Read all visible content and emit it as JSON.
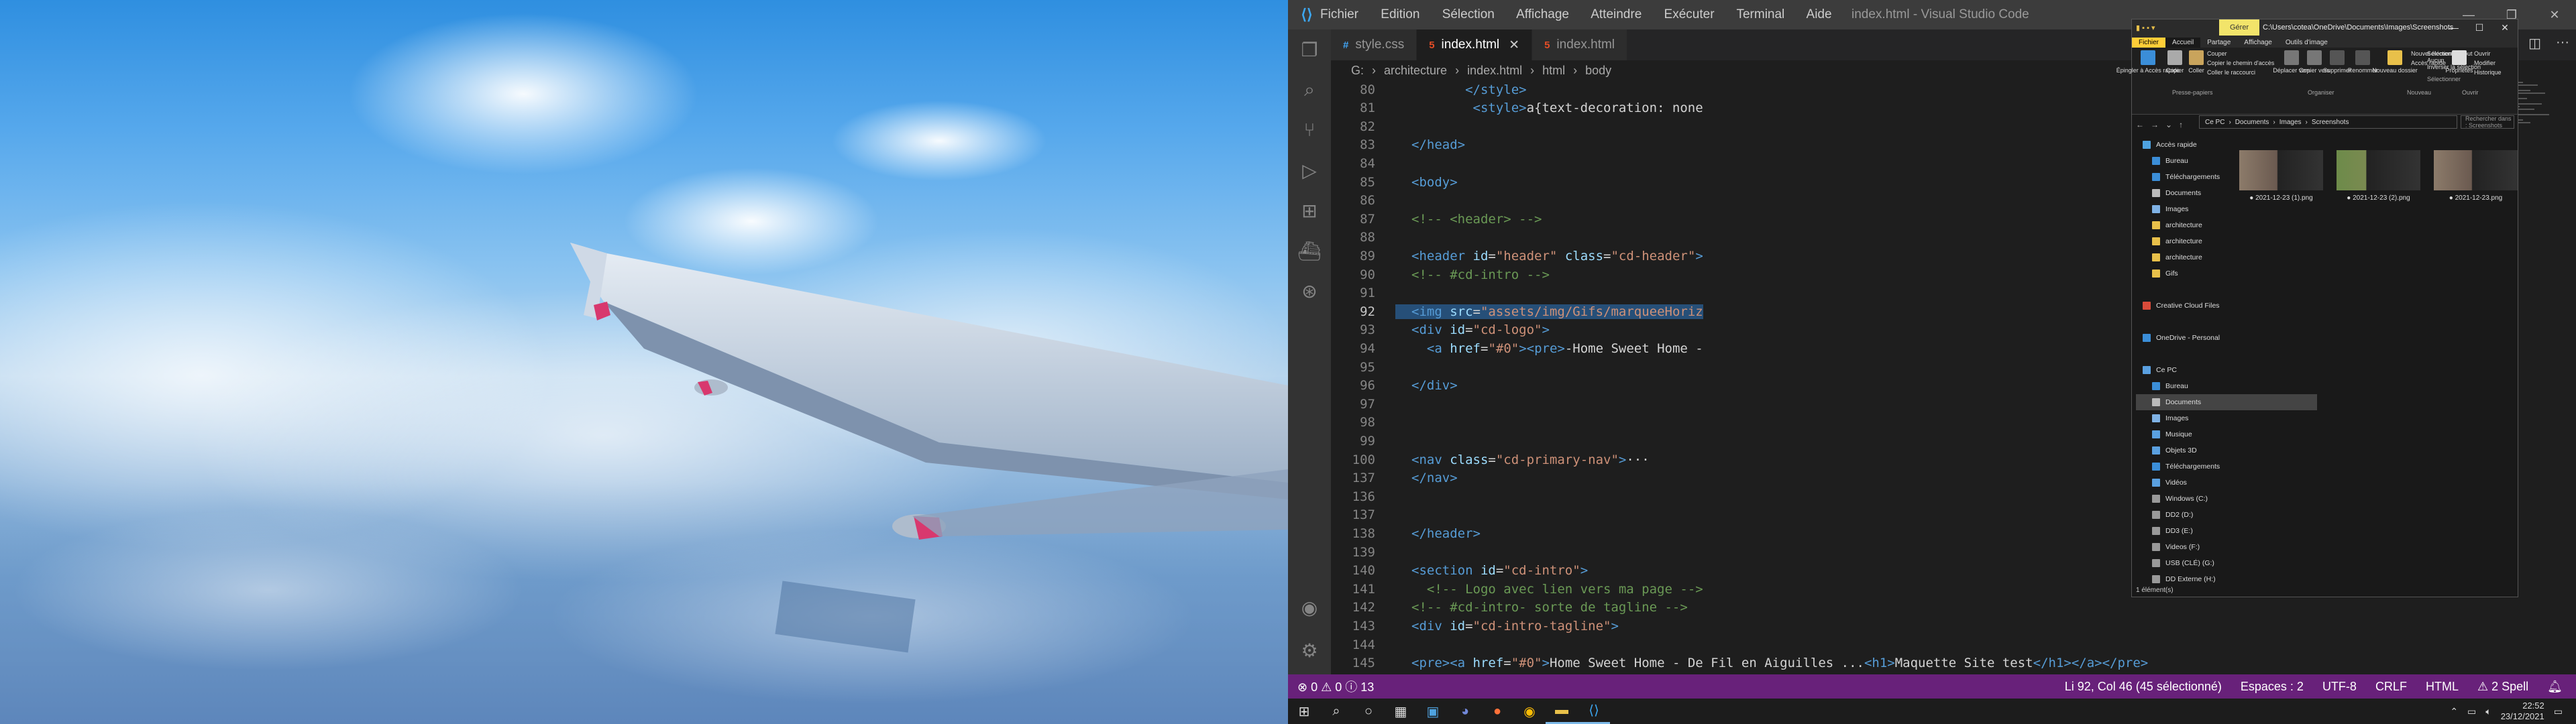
{
  "vscode": {
    "menu": [
      "Fichier",
      "Edition",
      "Sélection",
      "Affichage",
      "Atteindre",
      "Exécuter",
      "Terminal",
      "Aide"
    ],
    "window_title": "index.html - Visual Studio Code",
    "tabs": [
      {
        "icon": "#",
        "icon_color": "#42a5f5",
        "label": "style.css",
        "active": false
      },
      {
        "icon": "5",
        "icon_color": "#e44d26",
        "label": "index.html",
        "active": true
      },
      {
        "icon": "5",
        "icon_color": "#e44d26",
        "label": "index.html",
        "active": false
      }
    ],
    "breadcrumb": [
      "G:",
      "architecture",
      "index.html",
      "html",
      "body"
    ],
    "lines": [
      {
        "n": "80",
        "html": "<span class='txt'>       </span><span class='tag'>&lt;/style&gt;</span>"
      },
      {
        "n": "81",
        "html": "<span class='txt'>        </span><span class='tag'>&lt;style&gt;</span><span class='txt'>a{text-decoration: none</span>"
      },
      {
        "n": "82",
        "html": ""
      },
      {
        "n": "83",
        "html": "<span class='tag'>&lt;/head&gt;</span>"
      },
      {
        "n": "84",
        "html": ""
      },
      {
        "n": "85",
        "html": "<span class='tag'>&lt;body&gt;</span>"
      },
      {
        "n": "86",
        "html": ""
      },
      {
        "n": "87",
        "html": "<span class='cmt'>&lt;!-- &lt;header&gt; --&gt;</span>"
      },
      {
        "n": "88",
        "html": ""
      },
      {
        "n": "89",
        "html": "<span class='tag'>&lt;header </span><span class='attr'>id</span><span class='txt'>=</span><span class='str'>\"header\"</span><span class='attr'> class</span><span class='txt'>=</span><span class='str'>\"cd-header\"</span><span class='tag'>&gt;</span>"
      },
      {
        "n": "90",
        "html": "<span class='cmt'>&lt;!-- #cd-intro --&gt;</span>"
      },
      {
        "n": "91",
        "html": ""
      },
      {
        "n": "92",
        "html": "<span class='tag'>&lt;img </span><span class='attr'>src</span><span class='txt'>=</span><span class='str'>\"assets/img/Gifs/marqueeHoriz</span>",
        "sel": true,
        "cur": true
      },
      {
        "n": "93",
        "html": "<span class='tag'>&lt;div </span><span class='attr'>id</span><span class='txt'>=</span><span class='str'>\"cd-logo\"</span><span class='tag'>&gt;</span>"
      },
      {
        "n": "94",
        "html": "<span class='txt'>  </span><span class='tag'>&lt;a </span><span class='attr'>href</span><span class='txt'>=</span><span class='str'>\"#0\"</span><span class='tag'>&gt;&lt;pre&gt;</span><span class='txt'>-Home Sweet Home -</span>"
      },
      {
        "n": "95",
        "html": ""
      },
      {
        "n": "96",
        "html": "<span class='tag'>&lt;/div&gt;</span>"
      },
      {
        "n": "97",
        "html": ""
      },
      {
        "n": "98",
        "html": ""
      },
      {
        "n": "99",
        "html": ""
      },
      {
        "n": "100",
        "html": "<span class='tag'>&lt;nav </span><span class='attr'>class</span><span class='txt'>=</span><span class='str'>\"cd-primary-nav\"</span><span class='tag'>&gt;</span><span class='txt'>···</span>"
      },
      {
        "n": "137",
        "html": "<span class='tag'>&lt;/nav&gt;</span>"
      },
      {
        "n": "136",
        "html": ""
      },
      {
        "n": "137",
        "html": ""
      },
      {
        "n": "138",
        "html": "<span class='tag'>&lt;/header&gt;</span>"
      },
      {
        "n": "139",
        "html": ""
      },
      {
        "n": "140",
        "html": "<span class='tag'>&lt;section </span><span class='attr'>id</span><span class='txt'>=</span><span class='str'>\"cd-intro\"</span><span class='tag'>&gt;</span>"
      },
      {
        "n": "141",
        "html": "<span class='txt'>  </span><span class='cmt'>&lt;!-- Logo avec lien vers ma page --&gt;</span>"
      },
      {
        "n": "142",
        "html": "<span class='cmt'>&lt;!-- #cd-intro- sorte de tagline --&gt;</span>"
      },
      {
        "n": "143",
        "html": "<span class='tag'>&lt;div </span><span class='attr'>id</span><span class='txt'>=</span><span class='str'>\"cd-intro-tagline\"</span><span class='tag'>&gt;</span>"
      },
      {
        "n": "144",
        "html": ""
      },
      {
        "n": "145",
        "html": "<span class='tag'>&lt;pre&gt;&lt;a </span><span class='attr'>href</span><span class='txt'>=</span><span class='str'>\"#0\"</span><span class='tag'>&gt;</span><span class='txt'>Home Sweet Home - De Fil en Aiguilles ...</span><span class='tag'>&lt;h1&gt;</span><span class='txt'>Maquette Site test</span><span class='tag'>&lt;/h1&gt;&lt;/a&gt;&lt;/pre&gt;</span>"
      }
    ],
    "status": {
      "left": "⊗ 0 ⚠ 0 ⓘ 13",
      "right": [
        "Li 92, Col 46 (45 sélectionné)",
        "Espaces : 2",
        "UTF-8",
        "CRLF",
        "HTML",
        "⚠ 2 Spell"
      ]
    }
  },
  "taskbar": {
    "time": "22:52",
    "date": "23/12/2021"
  },
  "explorer": {
    "title_path": "C:\\Users\\cotea\\OneDrive\\Documents\\Images\\Screenshots",
    "tools_tab": "Gérer",
    "tabs": [
      "Fichier",
      "Accueil",
      "Partage",
      "Affichage",
      "Outils d'image"
    ],
    "ribbon": {
      "pin": "Épingler à Accès rapide",
      "copy": "Copier",
      "paste": "Coller",
      "cut": "Couper",
      "copy_path": "Copier le chemin d'accès",
      "paste_shortcut": "Coller le raccourci",
      "group_clipboard": "Presse-papiers",
      "move_to": "Déplacer vers",
      "copy_to": "Copier vers",
      "delete": "Supprimer",
      "rename": "Renommer",
      "group_organize": "Organiser",
      "new_folder": "Nouveau dossier",
      "new_item": "Nouvel élément",
      "easy_access": "Accès rapide",
      "group_new": "Nouveau",
      "properties": "Propriétés",
      "open": "Ouvrir",
      "edit": "Modifier",
      "history": "Historique",
      "group_open": "Ouvrir",
      "select_all": "Sélectionner tout",
      "select_none": "Aucun",
      "invert": "Inverser la sélection",
      "group_select": "Sélectionner"
    },
    "address": [
      "Ce PC",
      "Documents",
      "Images",
      "Screenshots"
    ],
    "search_placeholder": "Rechercher dans : Screenshots",
    "tree": [
      {
        "label": "Accès rapide",
        "color": "#4fa3e0",
        "indent": 0
      },
      {
        "label": "Bureau",
        "color": "#3b8ed8",
        "indent": 1
      },
      {
        "label": "Téléchargements",
        "color": "#3b8ed8",
        "indent": 1
      },
      {
        "label": "Documents",
        "color": "#bbbbbb",
        "indent": 1
      },
      {
        "label": "Images",
        "color": "#7fb2e5",
        "indent": 1
      },
      {
        "label": "architecture",
        "color": "#e8c04a",
        "indent": 1
      },
      {
        "label": "architecture",
        "color": "#e8c04a",
        "indent": 1
      },
      {
        "label": "architecture",
        "color": "#e8c04a",
        "indent": 1
      },
      {
        "label": "Gifs",
        "color": "#e8c04a",
        "indent": 1
      },
      {
        "label": "",
        "color": "",
        "indent": 0
      },
      {
        "label": "Creative Cloud Files",
        "color": "#d94b3a",
        "indent": 0
      },
      {
        "label": "",
        "color": "",
        "indent": 0
      },
      {
        "label": "OneDrive - Personal",
        "color": "#3b8ed8",
        "indent": 0
      },
      {
        "label": "",
        "color": "",
        "indent": 0
      },
      {
        "label": "Ce PC",
        "color": "#5aa0e0",
        "indent": 0
      },
      {
        "label": "Bureau",
        "color": "#3b8ed8",
        "indent": 1
      },
      {
        "label": "Documents",
        "color": "#bbbbbb",
        "indent": 1,
        "sel": true
      },
      {
        "label": "Images",
        "color": "#7fb2e5",
        "indent": 1
      },
      {
        "label": "Musique",
        "color": "#5aa0e0",
        "indent": 1
      },
      {
        "label": "Objets 3D",
        "color": "#5aa0e0",
        "indent": 1
      },
      {
        "label": "Téléchargements",
        "color": "#3b8ed8",
        "indent": 1
      },
      {
        "label": "Vidéos",
        "color": "#5aa0e0",
        "indent": 1
      },
      {
        "label": "Windows (C:)",
        "color": "#999999",
        "indent": 1
      },
      {
        "label": "DD2 (D:)",
        "color": "#999999",
        "indent": 1
      },
      {
        "label": "DD3 (E:)",
        "color": "#999999",
        "indent": 1
      },
      {
        "label": "Videos (F:)",
        "color": "#999999",
        "indent": 1
      },
      {
        "label": "USB (CLÉ) (G:)",
        "color": "#999999",
        "indent": 1
      },
      {
        "label": "DD Externe (H:)",
        "color": "#999999",
        "indent": 1
      }
    ],
    "files": [
      "2021-12-23 (1).png",
      "2021-12-23 (2).png",
      "2021-12-23.png"
    ],
    "status": "1 élément(s)"
  }
}
